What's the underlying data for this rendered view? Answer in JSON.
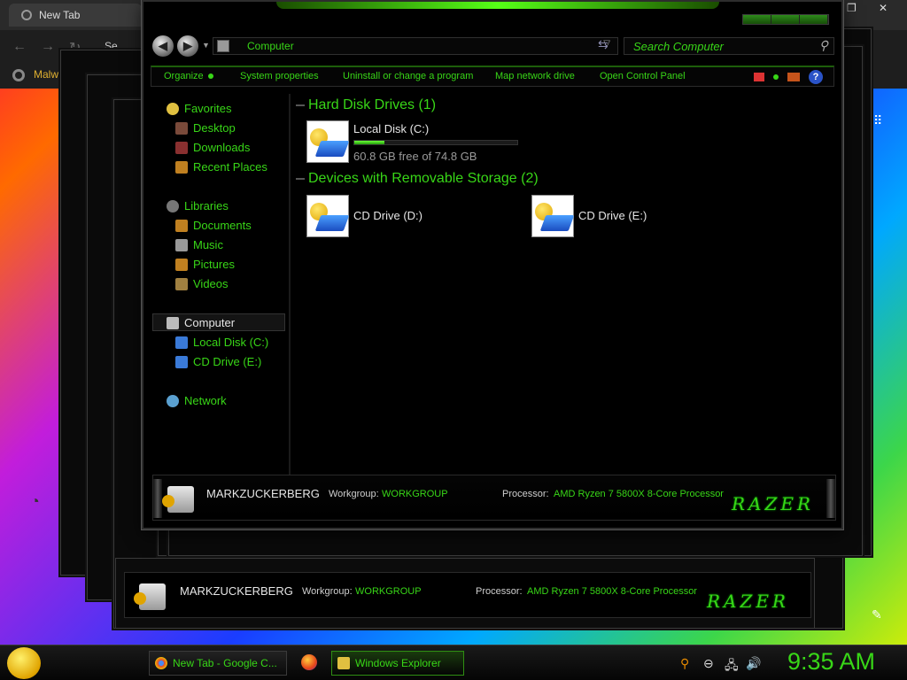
{
  "browser": {
    "tab_title": "New Tab",
    "search_partial": "Se",
    "bookmark": "Malw"
  },
  "window": {
    "address": "Computer",
    "search_placeholder": "Search Computer"
  },
  "commands": [
    "Organize",
    "System properties",
    "Uninstall or change a program",
    "Map network drive",
    "Open Control Panel"
  ],
  "nav": {
    "favorites": "Favorites",
    "favorites_items": [
      "Desktop",
      "Downloads",
      "Recent Places"
    ],
    "libraries": "Libraries",
    "libraries_items": [
      "Documents",
      "Music",
      "Pictures",
      "Videos"
    ],
    "computer": "Computer",
    "computer_items": [
      "Local Disk (C:)",
      "CD Drive (E:)"
    ],
    "network": "Network"
  },
  "groups": {
    "hdd": "Hard Disk Drives (1)",
    "removable": "Devices with Removable Storage (2)"
  },
  "drives": {
    "c": {
      "name": "Local Disk (C:)",
      "free_text": "60.8 GB free of 74.8 GB",
      "used_fraction": 0.187
    },
    "d": {
      "name": "CD Drive (D:)"
    },
    "e": {
      "name": "CD Drive (E:)"
    }
  },
  "details": {
    "computer_name": "MARKZUCKERBERG",
    "workgroup_label": "Workgroup:",
    "workgroup": "WORKGROUP",
    "processor_label": "Processor:",
    "processor": "AMD Ryzen 7 5800X 8-Core Processor",
    "brand": "RAZER"
  },
  "taskbar": {
    "items": [
      "New Tab - Google C...",
      "Windows Explorer"
    ],
    "clock": "9:35 AM"
  },
  "colors": {
    "accent": "#38d617",
    "background": "#000000"
  }
}
